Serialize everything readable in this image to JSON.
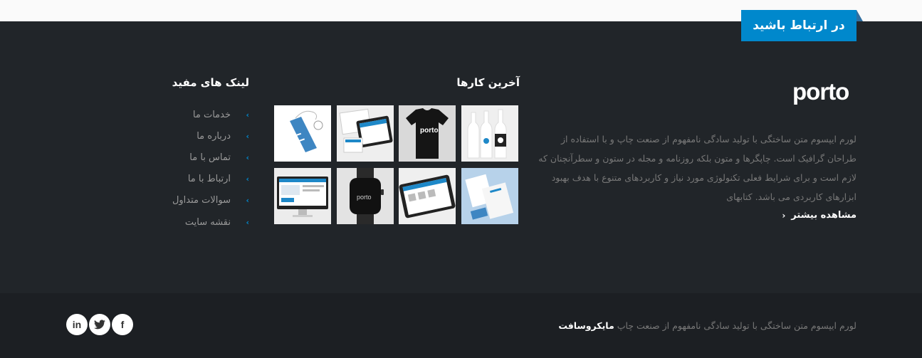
{
  "contact_tab": {
    "label": "در ارتباط باشید"
  },
  "brand": {
    "logo_text": "porto",
    "accent_color": "#0088cc"
  },
  "about": {
    "text": "لورم ایپسوم متن ساختگی با تولید سادگی نامفهوم از صنعت چاپ و با استفاده از طراحان گرافیک است. چاپگرها و متون بلکه روزنامه و مجله در ستون و سطرآنچنان که لازم است و برای شرایط فعلی تکنولوژی مورد نیاز و کاربردهای متنوع با هدف بهبود ابزارهای کاربردی می باشد. کتابهای",
    "more_label": "مشاهده بیشتر"
  },
  "works": {
    "title": "آخرین کارها",
    "items": [
      {
        "name": "bottles-mockup"
      },
      {
        "name": "tshirt-mockup"
      },
      {
        "name": "web-mockup"
      },
      {
        "name": "tag-mockup"
      },
      {
        "name": "stationery-mockup"
      },
      {
        "name": "tablet-mockup"
      },
      {
        "name": "watch-mockup"
      },
      {
        "name": "monitor-mockup"
      }
    ],
    "tshirt_logo": "porto",
    "watch_logo": "porto"
  },
  "links": {
    "title": "لینک های مفید",
    "items": [
      {
        "label": "خدمات ما"
      },
      {
        "label": "درباره ما"
      },
      {
        "label": "تماس با ما"
      },
      {
        "label": "ارتباط با ما"
      },
      {
        "label": "سوالات متداول"
      },
      {
        "label": "نقشه سایت"
      }
    ]
  },
  "footer": {
    "copyright": "لورم ایپسوم متن ساختگی با تولید سادگی نامفهوم از صنعت چاپ",
    "brand": "مایکروسافت"
  },
  "social": {
    "facebook": "f",
    "twitter": "twitter-icon",
    "linkedin": "in"
  }
}
